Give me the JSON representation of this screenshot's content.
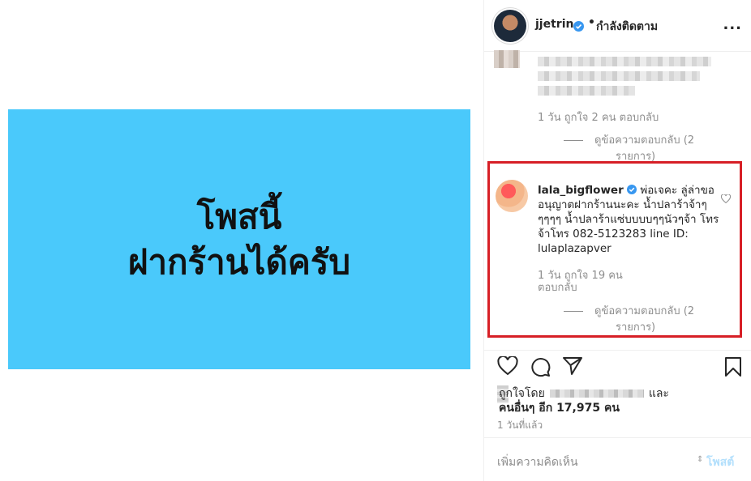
{
  "media": {
    "line1": "โพสนี้",
    "line2": "ฝากร้านได้ครับ",
    "background": "#4ac9fb"
  },
  "header": {
    "username": "jjetrin",
    "dot": "•",
    "follow_status": "กำลังติดตาม",
    "more": "..."
  },
  "comment1": {
    "meta": "1 วัน   ถูกใจ 2 คน   ตอบกลับ",
    "replies_line1": "ดูข้อความตอบกลับ (2",
    "replies_line2": "รายการ)"
  },
  "comment2": {
    "username": "lala_bigflower",
    "text": "พ่อเจคะ ลู่ล่าขออนุญาตฝากร้านนะคะ น้ำปลาร้าจ้าๆๆๆๆๆ น้ำปลาร้าแซ่บบบบๆๆนัวๆจ้า โทรจ้าโทร 082-5123283 line ID: lulaplazapver",
    "meta_line1": "1 วัน   ถูกใจ 19 คน",
    "meta_line2": "ตอบกลับ",
    "replies_line1": "ดูข้อความตอบกลับ (2",
    "replies_line2": "รายการ)",
    "highlight_color": "#d71f26"
  },
  "likes": {
    "liked_by": "ถูกใจโดย",
    "and": "และ",
    "others": "คนอื่นๆ อีก 17,975 คน"
  },
  "timestamp": "1 วันที่แล้ว",
  "comment_input": {
    "placeholder": "เพิ่มความคิดเห็น",
    "post_label": "โพสต์"
  }
}
